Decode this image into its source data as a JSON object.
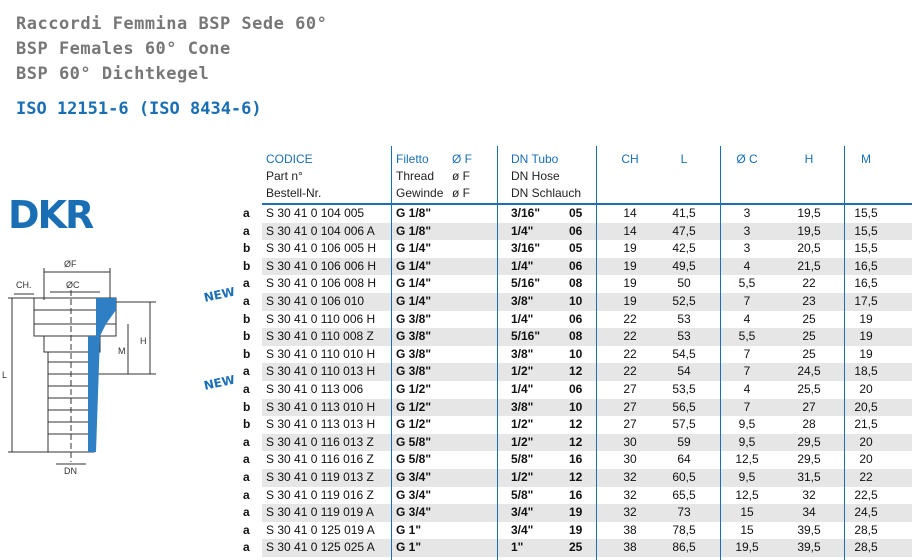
{
  "titles": [
    "Raccordi Femmina BSP Sede 60°",
    "BSP Females 60° Cone",
    "BSP 60° Dichtkegel"
  ],
  "standard": "ISO 12151-6 (ISO 8434-6)",
  "product_code": "DKR",
  "new_badge": "NEW",
  "drawing_labels": {
    "of": "ØF",
    "oc": "ØC",
    "ch": "CH.",
    "m": "M",
    "h": "H",
    "l": "L",
    "dn": "DN"
  },
  "headers": {
    "codice": [
      "CODICE",
      "Part n°",
      "Bestell-Nr."
    ],
    "filetto": [
      "Filetto",
      "Thread",
      "Gewinde"
    ],
    "of": [
      "Ø F",
      "ø F",
      "ø F"
    ],
    "dn": [
      "DN Tubo",
      "DN Hose",
      "DN Schlauch"
    ],
    "ch": "CH",
    "l": "L",
    "oc": "Ø C",
    "h": "H",
    "m": "M"
  },
  "rows": [
    {
      "g": "a",
      "code": "S 30 41 0 104 005",
      "thread": "G 1/8\"",
      "inch": "3/16\"",
      "dn": "05",
      "ch": "14",
      "l": "41,5",
      "oc": "3",
      "h": "19,5",
      "m": "15,5",
      "new": false
    },
    {
      "g": "a",
      "code": "S 30 41 0 104 006 A",
      "thread": "G 1/8\"",
      "inch": "1/4\"",
      "dn": "06",
      "ch": "14",
      "l": "47,5",
      "oc": "3",
      "h": "19,5",
      "m": "15,5",
      "new": false
    },
    {
      "g": "b",
      "code": "S 30 41 0 106 005 H",
      "thread": "G 1/4\"",
      "inch": "3/16\"",
      "dn": "05",
      "ch": "19",
      "l": "42,5",
      "oc": "3",
      "h": "20,5",
      "m": "15,5",
      "new": false
    },
    {
      "g": "b",
      "code": "S 30 41 0 106 006 H",
      "thread": "G 1/4\"",
      "inch": "1/4\"",
      "dn": "06",
      "ch": "19",
      "l": "49,5",
      "oc": "4",
      "h": "21,5",
      "m": "16,5",
      "new": false
    },
    {
      "g": "a",
      "code": "S 30 41 0 106 008 H",
      "thread": "G 1/4\"",
      "inch": "5/16\"",
      "dn": "08",
      "ch": "19",
      "l": "50",
      "oc": "5,5",
      "h": "22",
      "m": "16,5",
      "new": false
    },
    {
      "g": "a",
      "code": "S 30 41 0 106 010",
      "thread": "G 1/4\"",
      "inch": "3/8\"",
      "dn": "10",
      "ch": "19",
      "l": "52,5",
      "oc": "7",
      "h": "23",
      "m": "17,5",
      "new": true
    },
    {
      "g": "b",
      "code": "S 30 41 0 110 006 H",
      "thread": "G 3/8\"",
      "inch": "1/4\"",
      "dn": "06",
      "ch": "22",
      "l": "53",
      "oc": "4",
      "h": "25",
      "m": "19",
      "new": false
    },
    {
      "g": "b",
      "code": "S 30 41 0 110 008 Z",
      "thread": "G 3/8\"",
      "inch": "5/16\"",
      "dn": "08",
      "ch": "22",
      "l": "53",
      "oc": "5,5",
      "h": "25",
      "m": "19",
      "new": false
    },
    {
      "g": "b",
      "code": "S 30 41 0 110 010 H",
      "thread": "G 3/8\"",
      "inch": "3/8\"",
      "dn": "10",
      "ch": "22",
      "l": "54,5",
      "oc": "7",
      "h": "25",
      "m": "19",
      "new": false
    },
    {
      "g": "a",
      "code": "S 30 41 0 110 013 H",
      "thread": "G 3/8\"",
      "inch": "1/2\"",
      "dn": "12",
      "ch": "22",
      "l": "54",
      "oc": "7",
      "h": "24,5",
      "m": "18,5",
      "new": false
    },
    {
      "g": "a",
      "code": "S 30 41 0 113 006",
      "thread": "G 1/2\"",
      "inch": "1/4\"",
      "dn": "06",
      "ch": "27",
      "l": "53,5",
      "oc": "4",
      "h": "25,5",
      "m": "20",
      "new": true
    },
    {
      "g": "b",
      "code": "S 30 41 0 113 010 H",
      "thread": "G 1/2\"",
      "inch": "3/8\"",
      "dn": "10",
      "ch": "27",
      "l": "56,5",
      "oc": "7",
      "h": "27",
      "m": "20,5",
      "new": false
    },
    {
      "g": "b",
      "code": "S 30 41 0 113 013 H",
      "thread": "G 1/2\"",
      "inch": "1/2\"",
      "dn": "12",
      "ch": "27",
      "l": "57,5",
      "oc": "9,5",
      "h": "28",
      "m": "21,5",
      "new": false
    },
    {
      "g": "a",
      "code": "S 30 41 0 116 013 Z",
      "thread": "G 5/8\"",
      "inch": "1/2\"",
      "dn": "12",
      "ch": "30",
      "l": "59",
      "oc": "9,5",
      "h": "29,5",
      "m": "20",
      "new": false
    },
    {
      "g": "a",
      "code": "S 30 41 0 116 016 Z",
      "thread": "G 5/8\"",
      "inch": "5/8\"",
      "dn": "16",
      "ch": "30",
      "l": "64",
      "oc": "12,5",
      "h": "29,5",
      "m": "20",
      "new": false
    },
    {
      "g": "a",
      "code": "S 30 41 0 119 013 Z",
      "thread": "G 3/4\"",
      "inch": "1/2\"",
      "dn": "12",
      "ch": "32",
      "l": "60,5",
      "oc": "9,5",
      "h": "31,5",
      "m": "22",
      "new": false
    },
    {
      "g": "a",
      "code": "S 30 41 0 119 016 Z",
      "thread": "G 3/4\"",
      "inch": "5/8\"",
      "dn": "16",
      "ch": "32",
      "l": "65,5",
      "oc": "12,5",
      "h": "32",
      "m": "22,5",
      "new": false
    },
    {
      "g": "a",
      "code": "S 30 41 0 119 019 A",
      "thread": "G 3/4\"",
      "inch": "3/4\"",
      "dn": "19",
      "ch": "32",
      "l": "73",
      "oc": "15",
      "h": "34",
      "m": "24,5",
      "new": false
    },
    {
      "g": "a",
      "code": "S 30 41 0 125 019 A",
      "thread": "G 1\"",
      "inch": "3/4\"",
      "dn": "19",
      "ch": "38",
      "l": "78,5",
      "oc": "15",
      "h": "39,5",
      "m": "28,5",
      "new": false
    },
    {
      "g": "a",
      "code": "S 30 41 0 125 025 A",
      "thread": "G 1\"",
      "inch": "1\"",
      "dn": "25",
      "ch": "38",
      "l": "86,5",
      "oc": "19,5",
      "h": "39,5",
      "m": "28,5",
      "new": false
    }
  ]
}
